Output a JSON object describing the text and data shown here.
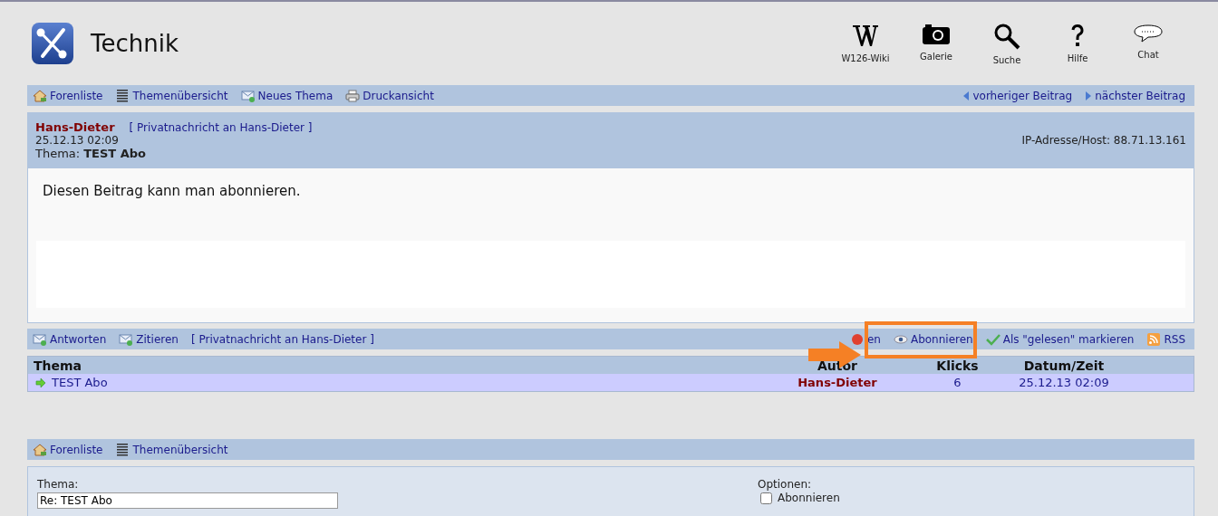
{
  "header": {
    "title": "Technik",
    "nav": [
      {
        "kind": "wiki",
        "label": "W126-Wiki"
      },
      {
        "kind": "gallery",
        "label": "Galerie"
      },
      {
        "kind": "search",
        "label": "Suche"
      },
      {
        "kind": "help",
        "label": "Hilfe"
      },
      {
        "kind": "chat",
        "label": "Chat"
      }
    ]
  },
  "toolbar": {
    "left": [
      {
        "kind": "home",
        "label": "Forenliste"
      },
      {
        "kind": "list",
        "label": "Themenübersicht"
      },
      {
        "kind": "mail",
        "label": "Neues Thema"
      },
      {
        "kind": "print",
        "label": "Druckansicht"
      }
    ],
    "right": [
      {
        "kind": "prev",
        "label": "vorheriger Beitrag"
      },
      {
        "kind": "next",
        "label": "nächster Beitrag"
      }
    ]
  },
  "post": {
    "author": "Hans-Dieter",
    "pm_link": "[ Privatnachricht an Hans-Dieter ]",
    "date": "25.12.13 02:09",
    "topic_label": "Thema:",
    "topic": "TEST Abo",
    "ip": "IP-Adresse/Host: 88.71.13.161",
    "body": "Diesen Beitrag kann man abonnieren."
  },
  "actions": {
    "left": [
      {
        "kind": "mail",
        "label": "Antworten"
      },
      {
        "kind": "mail",
        "label": "Zitieren"
      },
      {
        "kind": "plain",
        "label": "[ Privatnachricht an Hans-Dieter ]"
      }
    ],
    "right": [
      {
        "kind": "delete",
        "label": "en"
      },
      {
        "kind": "eye",
        "label": "Abonnieren"
      },
      {
        "kind": "check",
        "label": "Als \"gelesen\" markieren"
      },
      {
        "kind": "rss",
        "label": "RSS"
      }
    ]
  },
  "thread_table": {
    "columns": [
      "Thema",
      "Autor",
      "Klicks",
      "Datum/Zeit"
    ],
    "rows": [
      {
        "topic": "TEST Abo",
        "author": "Hans-Dieter",
        "clicks": "6",
        "date": "25.12.13 02:09",
        "selected": true
      }
    ]
  },
  "annotation": {
    "kind": "arrow-and-box"
  },
  "bottom_toolbar": [
    {
      "kind": "home",
      "label": "Forenliste"
    },
    {
      "kind": "list",
      "label": "Themenübersicht"
    }
  ],
  "reply_form": {
    "topic_label": "Thema:",
    "topic_value": "Re: TEST Abo",
    "options_label": "Optionen:",
    "options": [
      {
        "label": "Abonnieren",
        "checked": false
      }
    ]
  }
}
